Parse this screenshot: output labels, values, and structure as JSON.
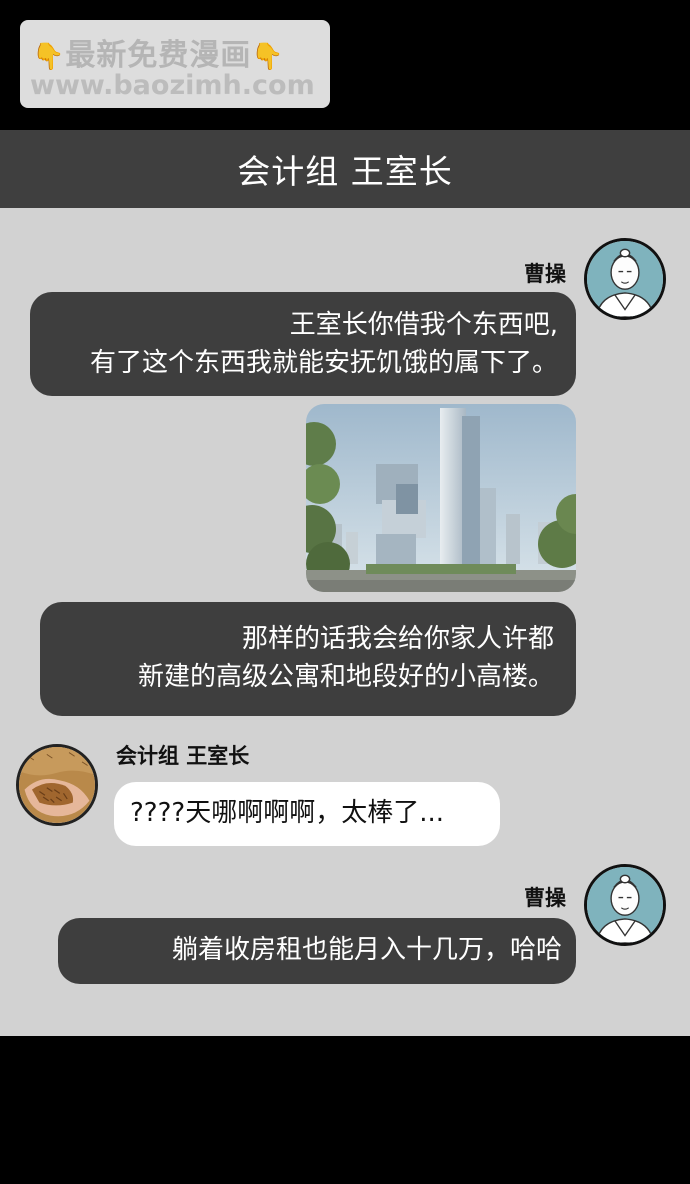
{
  "watermark": {
    "line1": "最新免费漫画",
    "line2": "www.baozimh.com",
    "hand_icon": "👇"
  },
  "header": {
    "title": "会计组 王室长"
  },
  "messages": [
    {
      "sender": "曹操",
      "lines": [
        "王室长你借我个东西吧,",
        "有了这个东西我就能安抚饥饿的属下了。"
      ]
    },
    {
      "sender": "曹操",
      "image": "city-skyscraper-photo"
    },
    {
      "sender": "曹操",
      "lines": [
        "那样的话我会给你家人许都",
        "新建的高级公寓和地段好的小高楼。"
      ]
    },
    {
      "sender": "会计组 王室长",
      "lines": [
        "????天哪啊啊啊，太棒了..."
      ]
    },
    {
      "sender": "曹操",
      "lines": [
        "躺着收房租也能月入十几万，哈哈"
      ]
    }
  ],
  "colors": {
    "background": "#000000",
    "header": "#3f3f3f",
    "chat_bg": "#d2d2d2",
    "dark_bubble": "#3e3e3e",
    "light_bubble": "#ffffff",
    "avatar_bg": "#7fb3bd"
  }
}
